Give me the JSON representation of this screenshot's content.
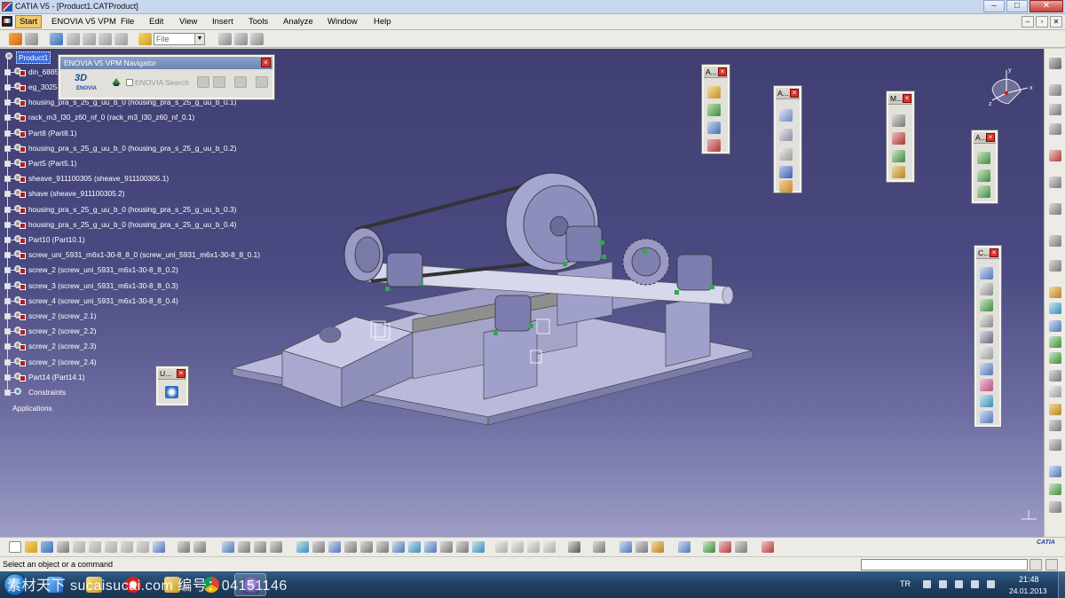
{
  "window": {
    "title": "CATIA V5 - [Product1.CATProduct]",
    "controls": [
      "–",
      "□",
      "✕"
    ]
  },
  "menubar": {
    "items": [
      "Start",
      "ENOVIA V5 VPM",
      "File",
      "Edit",
      "View",
      "Insert",
      "Tools",
      "Analyze",
      "Window",
      "Help"
    ],
    "doc_controls": [
      "–",
      "▫",
      "✕"
    ]
  },
  "toolbar_top": {
    "file_combo_value": "File"
  },
  "spec_tree": {
    "root": "Product1",
    "nodes": [
      "din_6885",
      "eg_3025-",
      "housing_pra_s_25_g_uu_b_0 (housing_pra_s_25_g_uu_b_0.1)",
      "rack_m3_l30_z60_nf_0 (rack_m3_l30_z60_nf_0.1)",
      "Part8 (Part8.1)",
      "housing_pra_s_25_g_uu_b_0 (housing_pra_s_25_g_uu_b_0.2)",
      "Part5 (Part5.1)",
      "sheave_911100305 (sheave_911100305.1)",
      "shave (sheave_911100305.2)",
      "housing_pra_s_25_g_uu_b_0 (housing_pra_s_25_g_uu_b_0.3)",
      "housing_pra_s_25_g_uu_b_0 (housing_pra_s_25_g_uu_b_0.4)",
      "Part10 (Part10.1)",
      "screw_uni_5931_m6x1-30-8_8_0 (screw_uni_5931_m6x1-30-8_8_0.1)",
      "screw_2 (screw_uni_5931_m6x1-30-8_8_0.2)",
      "screw_3 (screw_uni_5931_m6x1-30-8_8_0.3)",
      "screw_4 (screw_uni_5931_m6x1-30-8_8_0.4)",
      "screw_2 (screw_2.1)",
      "screw_2 (screw_2.2)",
      "screw_2 (screw_2.3)",
      "screw_2 (screw_2.4)",
      "Part14 (Part14.1)",
      "Constraints"
    ],
    "applications_label": "Applications"
  },
  "enovia_navigator": {
    "title": "ENOVIA V5 VPM Navigator",
    "logo_text": "ENOVIA",
    "search_label": "ENOVIA Search"
  },
  "floating_toolbars": [
    {
      "title": "A..."
    },
    {
      "title": "A..."
    },
    {
      "title": "M..."
    },
    {
      "title": "A..."
    },
    {
      "title": "C..."
    },
    {
      "title": "U..."
    }
  ],
  "compass": {
    "axis_labels": [
      "x",
      "y",
      "z"
    ]
  },
  "bottom_toolbar": {
    "brand": "CATIA"
  },
  "status_bar": {
    "message": "Select an object or a command",
    "command_input_value": ""
  },
  "taskbar": {
    "watermark": "素材天下 sucaisucai.com  编号：04151146",
    "language": "TR",
    "time": "21:48",
    "date": "24.01.2013"
  },
  "colors": {
    "viewport_top": "#3f3f72",
    "viewport_bottom": "#9c9cc6",
    "tree_selected": "#3a6bd8",
    "part_body": "#b4b4d8",
    "close_button": "#d23a2a"
  }
}
